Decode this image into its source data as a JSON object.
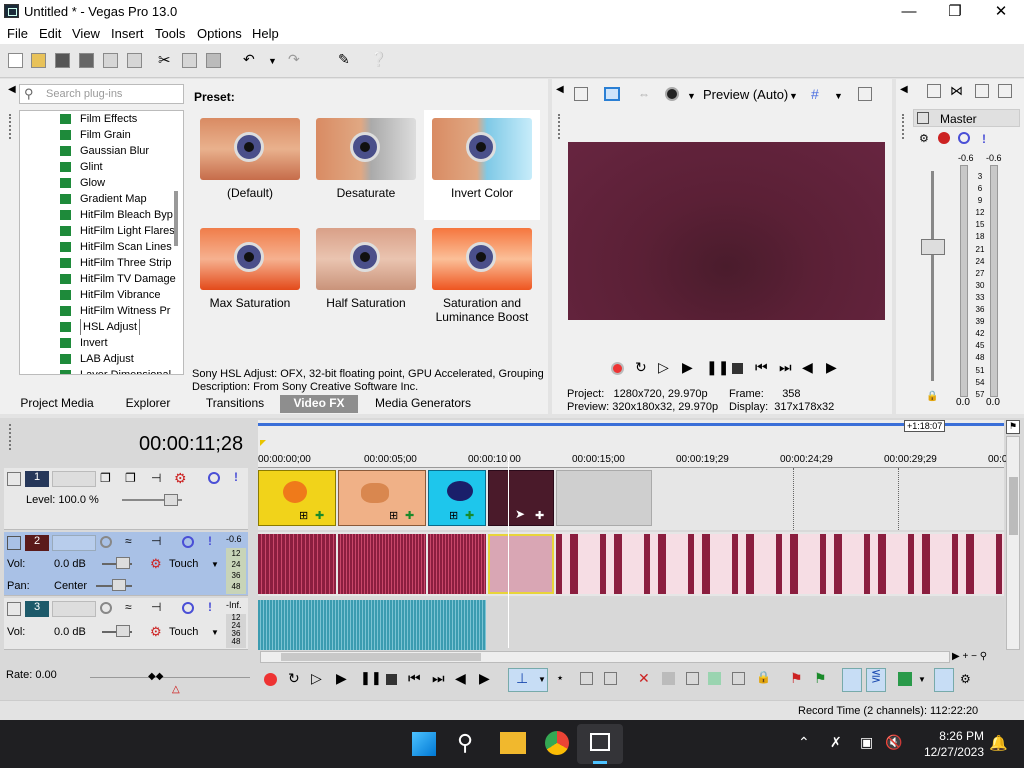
{
  "window": {
    "title": "Untitled * - Vegas Pro 13.0"
  },
  "menu": [
    "File",
    "Edit",
    "View",
    "Insert",
    "Tools",
    "Options",
    "Help"
  ],
  "plugins": {
    "search_placeholder": "Search plug-ins",
    "items": [
      "Film Effects",
      "Film Grain",
      "Gaussian Blur",
      "Glint",
      "Glow",
      "Gradient Map",
      "HitFilm Bleach Byp",
      "HitFilm Light Flares",
      "HitFilm Scan Lines",
      "HitFilm Three Strip",
      "HitFilm TV Damage",
      "HitFilm Vibrance",
      "HitFilm Witness Pr",
      "HSL Adjust",
      "Invert",
      "LAB Adjust",
      "Laver Dimensional"
    ],
    "selected": "HSL Adjust"
  },
  "preset": {
    "heading": "Preset:",
    "items": [
      "(Default)",
      "Desaturate",
      "Invert Color",
      "Max Saturation",
      "Half Saturation",
      "Saturation and Luminance Boost"
    ],
    "selected": "Invert Color",
    "description_line1": "Sony HSL Adjust: OFX, 32-bit floating point, GPU Accelerated, Grouping",
    "description_line2": "Description: From Sony Creative Software Inc."
  },
  "tabs": [
    "Project Media",
    "Explorer",
    "Transitions",
    "Video FX",
    "Media Generators"
  ],
  "active_tab": "Video FX",
  "preview": {
    "mode": "Preview (Auto)",
    "project_label": "Project:",
    "project_value": "1280x720, 29.970p",
    "preview_label": "Preview:",
    "preview_value": "320x180x32, 29.970p",
    "frame_label": "Frame:",
    "frame_value": "358",
    "display_label": "Display:",
    "display_value": "317x178x32"
  },
  "master": {
    "title": "Master",
    "peak_left": "-0.6",
    "peak_right": "-0.6",
    "scale": [
      "3",
      "6",
      "9",
      "12",
      "15",
      "18",
      "21",
      "24",
      "27",
      "30",
      "33",
      "36",
      "39",
      "42",
      "45",
      "48",
      "51",
      "54",
      "57"
    ],
    "bottom_left": "0.0",
    "bottom_right": "0.0"
  },
  "timeline": {
    "time": "00:00:11;28",
    "end_marker": "+1:18:07",
    "ruler": [
      "00:00:00;00",
      "00:00:05;00",
      "00:00:10;00",
      "00:00:15;00",
      "00:00:19;29",
      "00:00:24;29",
      "00:00:29;29",
      "00:0"
    ]
  },
  "tracks": [
    {
      "num": "1",
      "level_label": "Level: 100.0 %"
    },
    {
      "num": "2",
      "vol_label": "Vol:",
      "vol_value": "0.0 dB",
      "pan_label": "Pan:",
      "pan_value": "Center",
      "mode": "Touch",
      "meter_top": "-0.6",
      "meter_scale": [
        "12",
        "24",
        "36",
        "48"
      ]
    },
    {
      "num": "3",
      "vol_label": "Vol:",
      "vol_value": "0.0 dB",
      "mode": "Touch",
      "meter_top": "-Inf.",
      "meter_scale": [
        "12",
        "24",
        "36",
        "48"
      ]
    }
  ],
  "rate": "Rate: 0.00",
  "record_time": "Record Time (2 channels): 112:22:20",
  "taskbar": {
    "time": "8:26 PM",
    "date": "12/27/2023"
  },
  "colors": {
    "accent_blue": "#3a6fd8",
    "track_selected": "#a9c1e6",
    "wave": "#8b1e3f",
    "wave_teal": "#3b9bb0"
  }
}
